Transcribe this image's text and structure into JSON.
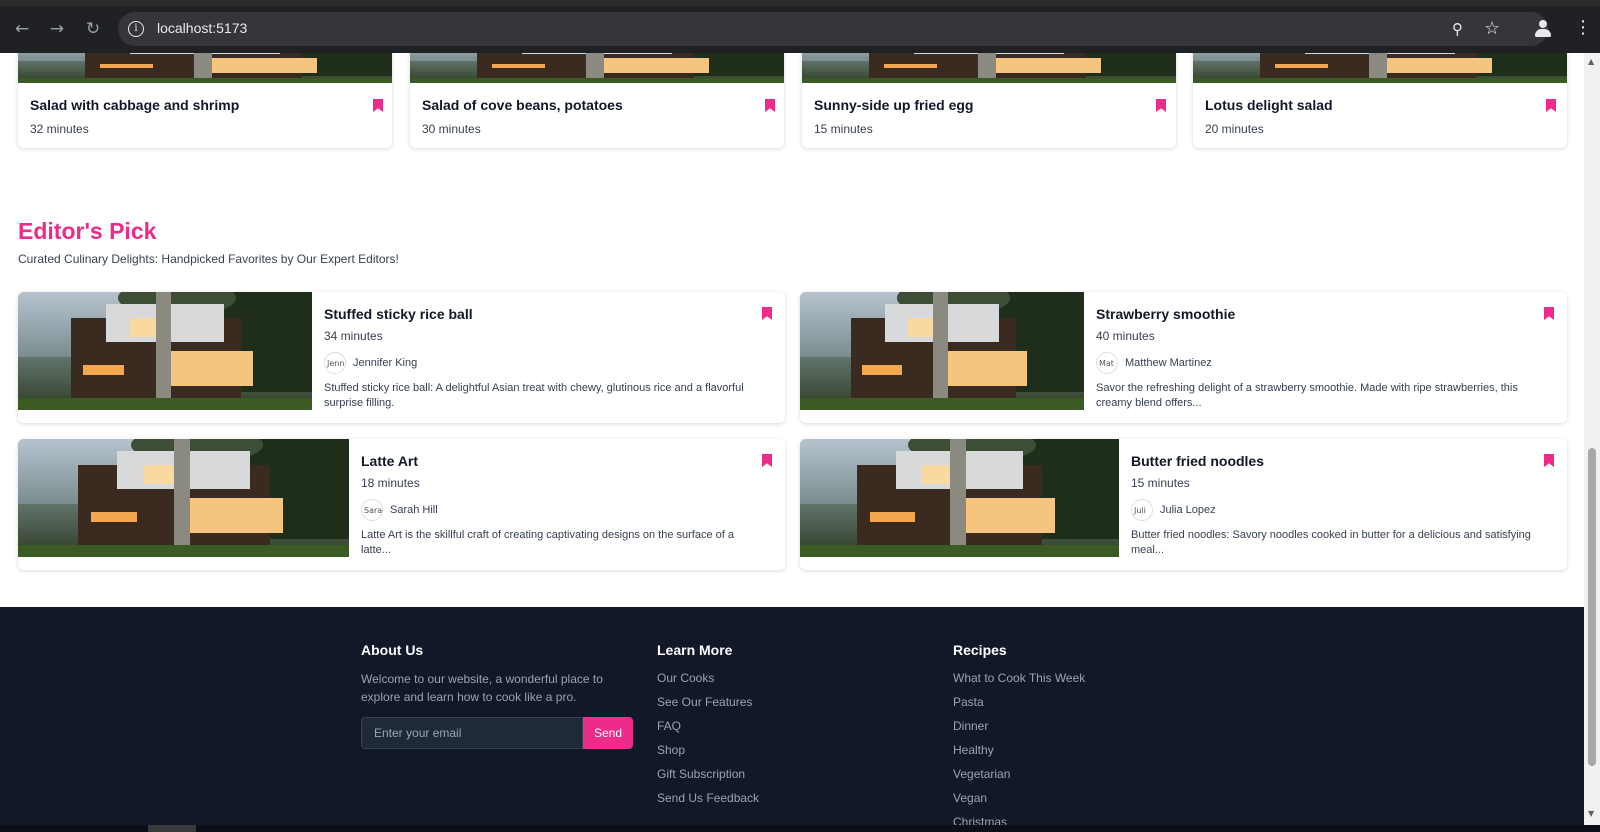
{
  "browser": {
    "url": "localhost:5173"
  },
  "top_cards": [
    {
      "title": "Salad with cabbage and shrimp",
      "time": "32 minutes"
    },
    {
      "title": "Salad of cove beans, potatoes",
      "time": "30 minutes"
    },
    {
      "title": "Sunny-side up fried egg",
      "time": "15 minutes"
    },
    {
      "title": "Lotus delight salad",
      "time": "20 minutes"
    }
  ],
  "editors_pick": {
    "title": "Editor's Pick",
    "subtitle": "Curated Culinary Delights: Handpicked Favorites by Our Expert Editors!",
    "cards": [
      {
        "title": "Stuffed sticky rice ball",
        "time": "34 minutes",
        "avatar_alt": "Jenn",
        "author": "Jennifer King",
        "description": "Stuffed sticky rice ball: A delightful Asian treat with chewy, glutinous rice and a flavorful surprise filling."
      },
      {
        "title": "Strawberry smoothie",
        "time": "40 minutes",
        "avatar_alt": "Mat",
        "author": "Matthew Martinez",
        "description": "Savor the refreshing delight of a strawberry smoothie. Made with ripe strawberries, this creamy blend offers..."
      },
      {
        "title": "Latte Art",
        "time": "18 minutes",
        "avatar_alt": "Sara",
        "author": "Sarah Hill",
        "description": "Latte Art is the skillful craft of creating captivating designs on the surface of a latte..."
      },
      {
        "title": "Butter fried noodles",
        "time": "15 minutes",
        "avatar_alt": "Juli",
        "author": "Julia Lopez",
        "description": "Butter fried noodles: Savory noodles cooked in butter for a delicious and satisfying meal..."
      }
    ]
  },
  "footer": {
    "about": {
      "title": "About Us",
      "text_line1": "Welcome to our website, a wonderful place to",
      "text_line2": "explore and learn how to cook like a pro.",
      "email_placeholder": "Enter your email",
      "send_label": "Send"
    },
    "learn_more": {
      "title": "Learn More",
      "links": [
        "Our Cooks",
        "See Our Features",
        "FAQ",
        "Shop",
        "Gift Subscription",
        "Send Us Feedback"
      ]
    },
    "recipes": {
      "title": "Recipes",
      "links": [
        "What to Cook This Week",
        "Pasta",
        "Dinner",
        "Healthy",
        "Vegetarian",
        "Vegan",
        "Christmas"
      ]
    }
  },
  "colors": {
    "accent": "#ec2b8b",
    "footer_bg": "#111827",
    "chrome_bg": "#202124"
  }
}
